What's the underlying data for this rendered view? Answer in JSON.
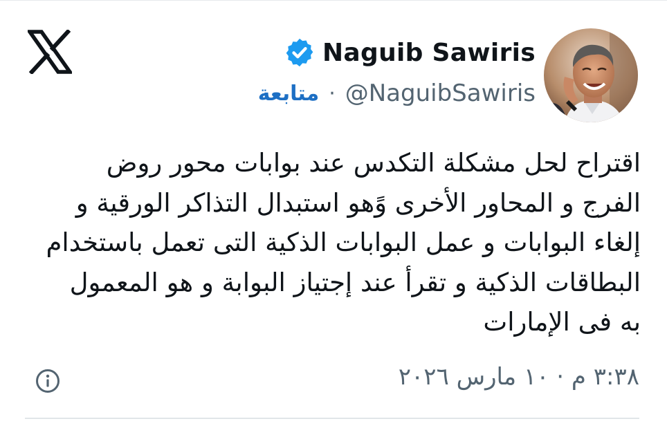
{
  "header": {
    "display_name": "Naguib Sawiris",
    "handle": "@NaguibSawiris",
    "separator": "·",
    "follow_label": "متابعة",
    "verified": true,
    "icons": {
      "logo": "x-logo-icon",
      "verified": "verified-badge-icon",
      "avatar": "profile-photo"
    }
  },
  "tweet": {
    "lines": [
      "اقتراح لحل مشكلة التكدس عند بوابات محور روض",
      "الفرج و المحاور الأخرى وًهو  استبدال التذاكر الورقية و",
      "إلغاء البوابات و عمل البوابات الذكية التى تعمل باستخدام",
      "البطاقات الذكية و تقرأ عند إجتياز  البوابة و هو المعمول",
      "به فى الإمارات"
    ]
  },
  "footer": {
    "timestamp": "٣:٣٨ م · ١٠ مارس ٢٠٢٦",
    "info_icon": "info-icon"
  },
  "colors": {
    "text": "#0f1419",
    "muted": "#536471",
    "link": "#1d6fc4",
    "verified": "#1d9bf0"
  }
}
